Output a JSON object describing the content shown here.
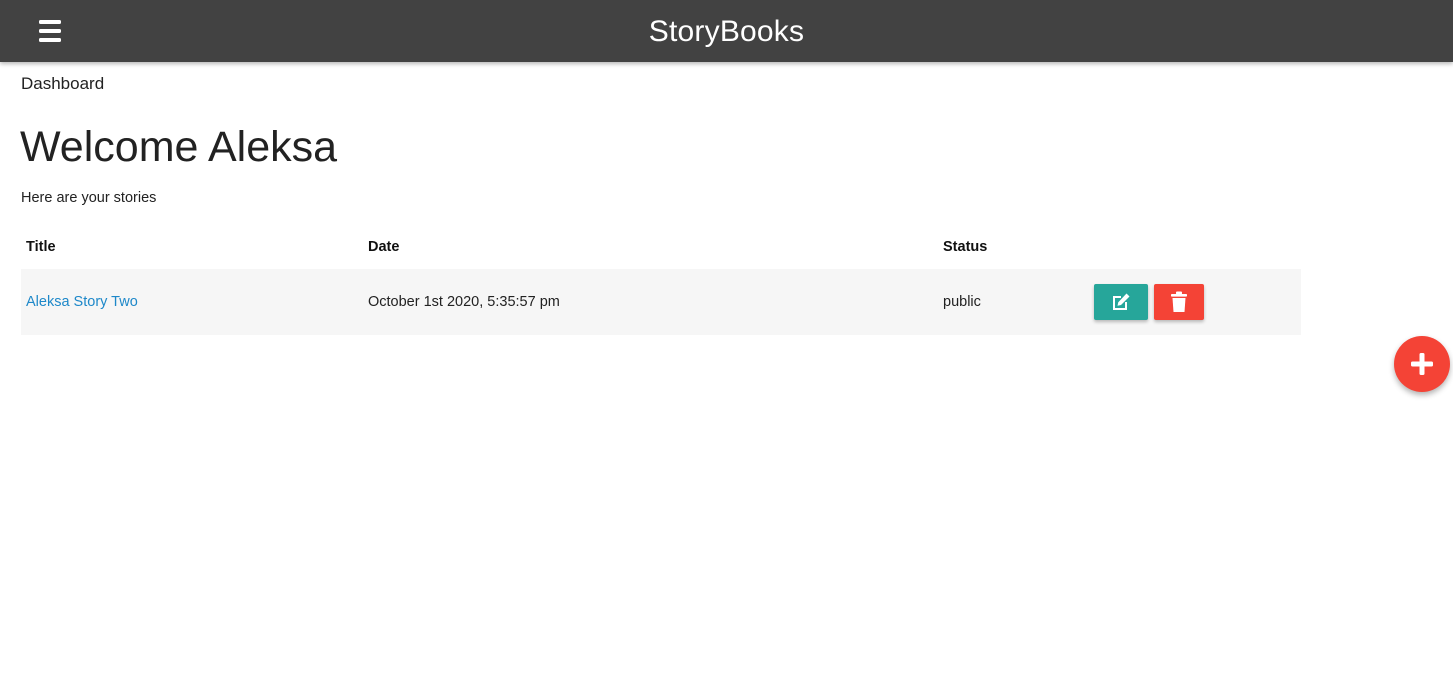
{
  "navbar": {
    "brand": "StoryBooks",
    "menu_icon": "hamburger-menu-icon",
    "background_color": "#424242"
  },
  "breadcrumb": "Dashboard",
  "main": {
    "heading": "Welcome Aleksa",
    "subtitle": "Here are your stories"
  },
  "table": {
    "headers": [
      "Title",
      "Date",
      "Status",
      ""
    ],
    "rows": [
      {
        "title": "Aleksa Story Two",
        "date": "October 1st 2020, 5:35:57 pm",
        "status": "public",
        "edit_icon": "edit-icon",
        "delete_icon": "trash-icon"
      }
    ]
  },
  "fab": {
    "icon": "plus-icon"
  },
  "colors": {
    "link": "#1e88c9",
    "edit_button": "#26a69a",
    "delete_button": "#f44336",
    "fab": "#f44336",
    "row_background": "#f6f6f6"
  }
}
